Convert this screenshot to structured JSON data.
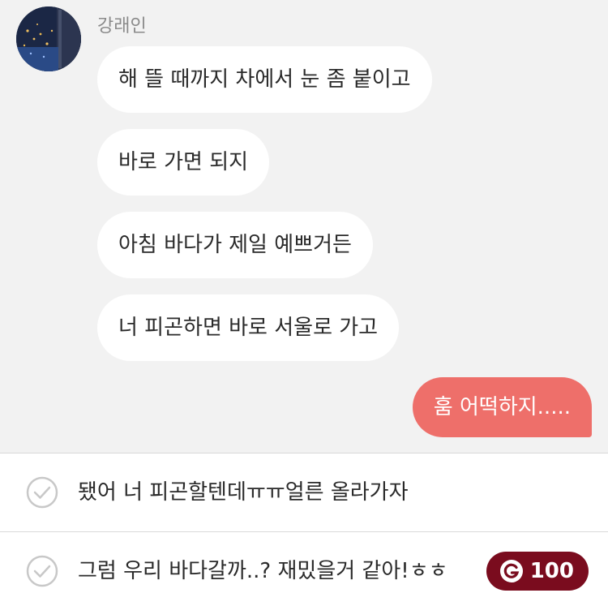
{
  "sender": {
    "name": "강래인"
  },
  "messages": [
    {
      "from": "other",
      "text": "해 뜰 때까지 차에서 눈 좀 붙이고"
    },
    {
      "from": "other",
      "text": "바로 가면 되지"
    },
    {
      "from": "other",
      "text": "아침 바다가 제일 예쁘거든"
    },
    {
      "from": "other",
      "text": "너 피곤하면 바로 서울로 가고"
    },
    {
      "from": "me",
      "text": "훔 어떡하지....."
    }
  ],
  "choices": [
    {
      "text": "됐어 너 피곤할텐데ㅠㅠ얼른 올라가자"
    },
    {
      "text": "그럼 우리 바다갈까..? 재밌을거 같아!ㅎㅎ",
      "cost": "100",
      "cost_icon": "coin-g-icon"
    }
  ],
  "colors": {
    "background": "#f2f2f2",
    "other_bubble": "#ffffff",
    "my_bubble": "#ee6f6a",
    "cost_badge": "#7a0c1e"
  }
}
